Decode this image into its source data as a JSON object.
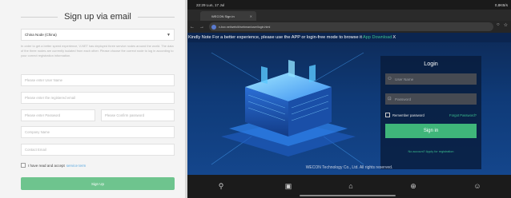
{
  "signup": {
    "title": "Sign up via email",
    "region_select": "China Node (China)",
    "note": "In order to get a better speed experience, V-NET has deployed three service nodes around the world. The data of the three nodes are currently isolated from each other. Please choose the correct node to log in according to your correct registration information.",
    "user_name_placeholder": "Please enter User Name",
    "email_placeholder": "Please enter the registered email",
    "password_placeholder": "Please enter Password",
    "confirm_password_placeholder": "Please Confirm password",
    "company_placeholder": "Company Name",
    "contact_email_placeholder": "Contact Email",
    "agree_text": "I have read and accept",
    "agree_link": "service term",
    "signup_button": "Sign Up",
    "accent_color": "#6ec48e"
  },
  "phone": {
    "statusbar": {
      "time_date": "22:29 Lun, 17 Jul",
      "right_info": "0,8KB/s"
    },
    "tab_title": "WECON Sign in",
    "url": "v-box.net/web/#/webman/user/login.html",
    "notice": {
      "text": "Kindly Note For a better experience, please use the APP or login-free mode to browse it",
      "link": "App Download",
      "close": "X"
    },
    "login": {
      "title": "Login",
      "user_placeholder": "User Name",
      "password_placeholder": "Password",
      "remember": "Remember password",
      "forgot": "Forgot Password?",
      "signin_button": "Sign in",
      "register_link": "No account? Apply for registration"
    },
    "footer": "WECON Technology Co., Ltd. All rights reserved.",
    "accent_color": "#3fb57a"
  }
}
